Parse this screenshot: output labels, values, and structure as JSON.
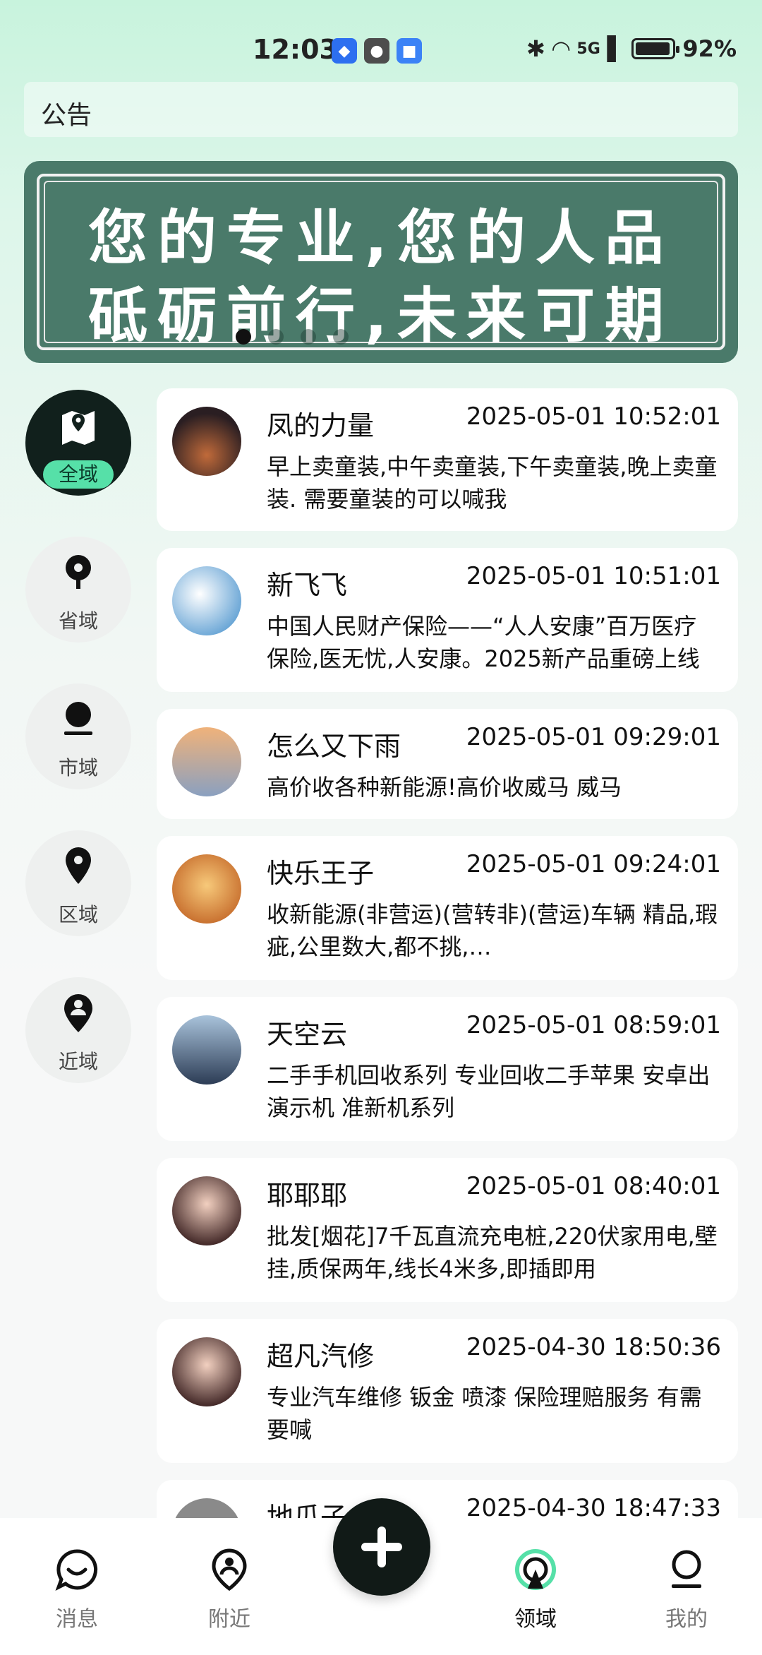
{
  "status_bar": {
    "time": "12:03",
    "battery": "92%",
    "network": "5G"
  },
  "notice": {
    "label": "公告"
  },
  "banner": {
    "line1": "您的专业,您的人品",
    "line2": "砥砺前行,未来可期",
    "active_dot": 0,
    "dot_count": 4
  },
  "categories": [
    {
      "label": "全域",
      "icon": "map-icon",
      "active": true
    },
    {
      "label": "省域",
      "icon": "pin-icon",
      "active": false
    },
    {
      "label": "市域",
      "icon": "pin-icon",
      "active": false
    },
    {
      "label": "区域",
      "icon": "pin-icon",
      "active": false
    },
    {
      "label": "近域",
      "icon": "person-pin-icon",
      "active": false
    }
  ],
  "posts": [
    {
      "name": "凤的力量",
      "time": "2025-05-01 10:52:01",
      "text": "早上卖童装,中午卖童装,下午卖童装,晚上卖童装. 需要童装的可以喊我",
      "avatar_color": "#3b2a2a"
    },
    {
      "name": "新飞飞",
      "time": "2025-05-01 10:51:01",
      "text": "中国人民财产保险——“人人安康”百万医疗保险,医无忧,人安康。2025新产品重磅上线",
      "avatar_color": "#6aa6d6"
    },
    {
      "name": "怎么又下雨",
      "time": "2025-05-01 09:29:01",
      "text": "高价收各种新能源!高价收威马 威马",
      "avatar_color": "#d9a070"
    },
    {
      "name": "快乐王子",
      "time": "2025-05-01 09:24:01",
      "text": "收新能源(非营运)(营转非)(营运)车辆 精品,瑕疵,公里数大,都不挑,…",
      "avatar_color": "#e8a64a"
    },
    {
      "name": "天空云",
      "time": "2025-05-01 08:59:01",
      "text": "二手手机回收系列 专业回收二手苹果 安卓出演示机 准新机系列",
      "avatar_color": "#8aa7c2"
    },
    {
      "name": "耶耶耶",
      "time": "2025-05-01 08:40:01",
      "text": "批发[烟花]7千瓦直流充电桩,220伏家用电,壁挂,质保两年,线长4米多,即插即用",
      "avatar_color": "#5a3b3b"
    },
    {
      "name": "超凡汽修",
      "time": "2025-04-30 18:50:36",
      "text": "专业汽车维修 钣金 喷漆 保险理赔服务 有需要喊",
      "avatar_color": "#4a3030"
    },
    {
      "name": "地瓜子",
      "time": "2025-04-30 18:47:33",
      "text": "",
      "avatar_color": "#888888"
    }
  ],
  "nav": [
    {
      "label": "消息",
      "icon": "message-icon"
    },
    {
      "label": "附近",
      "icon": "location-icon"
    },
    {
      "label": "领域",
      "icon": "signal-icon",
      "active": true
    },
    {
      "label": "我的",
      "icon": "profile-icon"
    }
  ],
  "colors": {
    "accent": "#56e0a8",
    "banner_bg": "#4a7a6a",
    "dark": "#11201c"
  }
}
